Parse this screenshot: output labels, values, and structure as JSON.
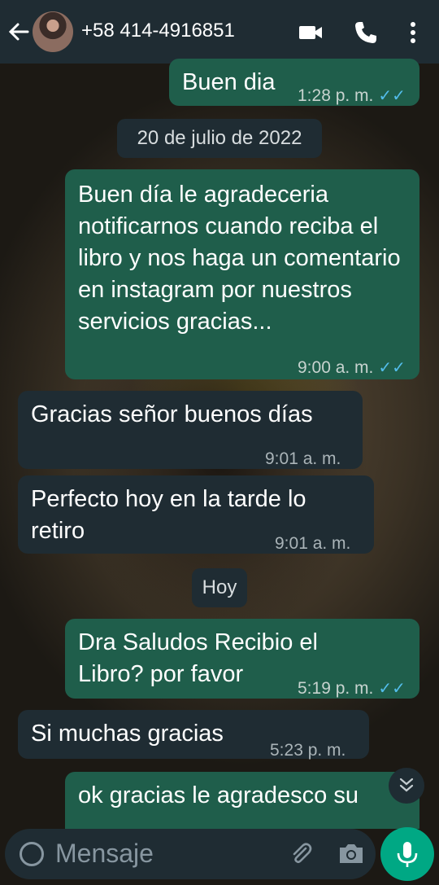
{
  "header": {
    "contact_name": "+58 414-4916851",
    "icons": [
      "back-arrow-icon",
      "avatar",
      "video-call-icon",
      "phone-call-icon",
      "more-options-icon"
    ]
  },
  "messages": [
    {
      "dir": "out",
      "text": "Buen dia",
      "time": "1:28 p. m.",
      "read": true
    },
    {
      "dir": "out",
      "text": "Buen día le agradeceria notificarnos cuando reciba el libro y nos haga un comentario en instagram por nuestros servicios gracias...",
      "time": "9:00 a. m.",
      "read": true
    },
    {
      "dir": "in",
      "text": "Gracias señor buenos días",
      "time": "9:01 a. m."
    },
    {
      "dir": "in",
      "text": "Perfecto hoy en la tarde lo retiro",
      "time": "9:01 a. m."
    },
    {
      "dir": "out",
      "text": "Dra Saludos Recibio el Libro? por favor",
      "time": "5:19 p. m.",
      "read": true
    },
    {
      "dir": "in",
      "text": "Si muchas gracias",
      "time": "5:23 p. m."
    },
    {
      "dir": "out",
      "text": "ok gracias le agradesco su",
      "time": "",
      "read": false
    }
  ],
  "date_chips": [
    "20 de julio de 2022",
    "Hoy"
  ],
  "composer": {
    "placeholder": "Mensaje"
  },
  "colors": {
    "header": "#1f2c33",
    "outgoing": "#1f5e4b",
    "incoming": "#1f2c33",
    "tick": "#53bdeb",
    "accent": "#00a884"
  }
}
